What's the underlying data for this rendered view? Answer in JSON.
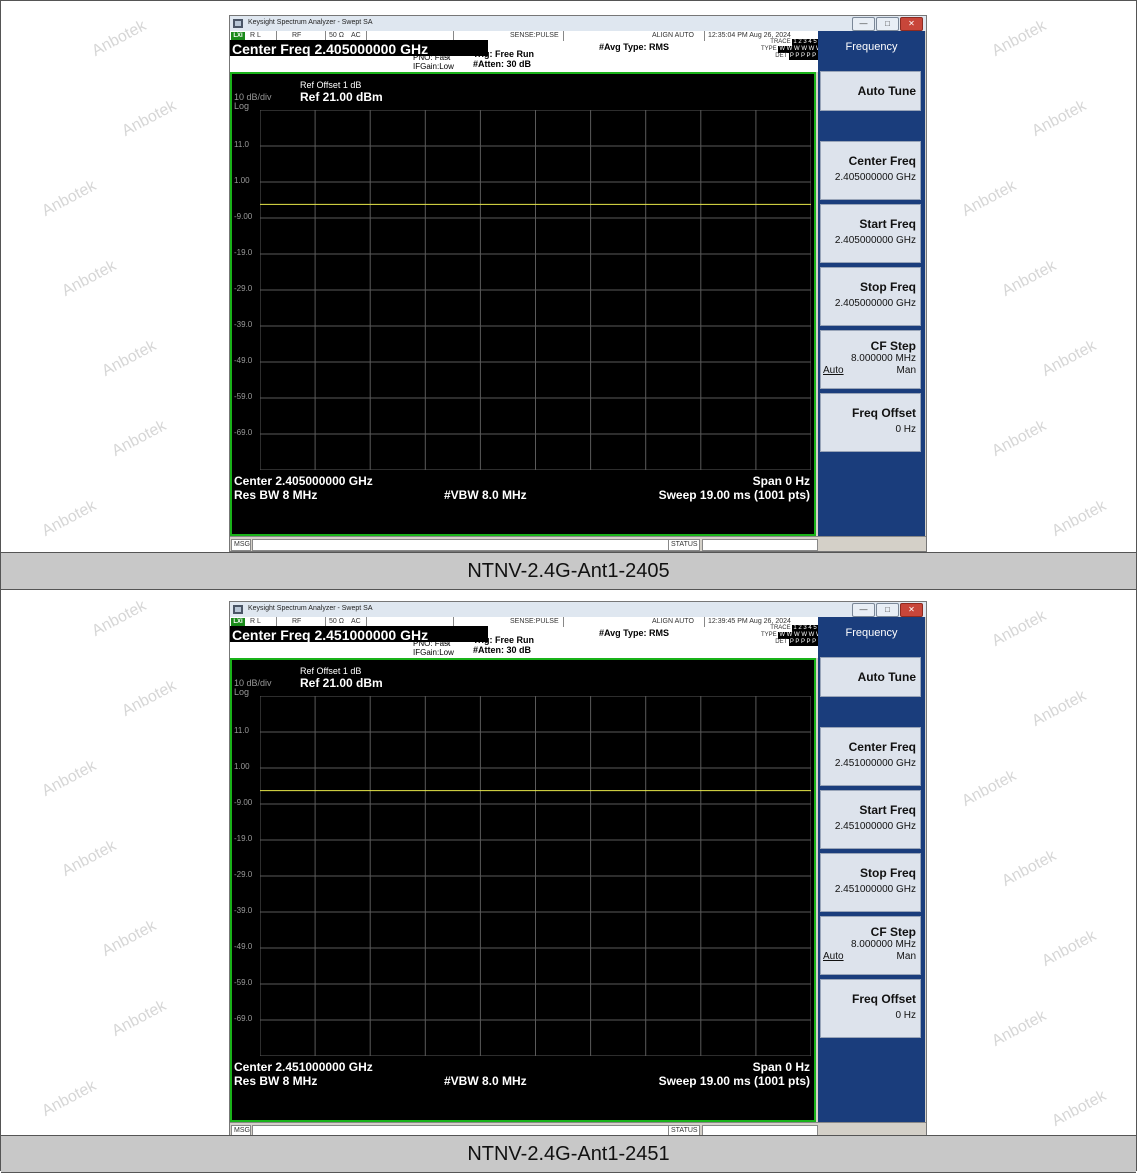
{
  "watermark": "Anbotek",
  "screens": [
    {
      "caption": "NTNV-2.4G-Ant1-2405",
      "window": {
        "title": "Keysight Spectrum Analyzer - Swept SA",
        "lxi": "LXI",
        "rl": "R L",
        "rf": "RF",
        "impedance": "50 Ω",
        "coupling": "AC",
        "sense": "SENSE:PULSE",
        "align": "ALIGN AUTO",
        "timestamp": "12:35:04 PM Aug 26, 2024",
        "center_freq_header": "Center Freq 2.405000000 GHz",
        "pno": "PNO: Fast",
        "ifgain": "IFGain:Low",
        "trig": "Trig: Free Run",
        "atten": "#Atten: 30 dB",
        "avg_type": "#Avg Type: RMS",
        "trace_label": "TRACE",
        "trace_nums": "1 2 3 4 5 6",
        "type_label": "TYPE",
        "type_val": "W W W W W W",
        "det_label": "DET",
        "det_val": "P P P P P P",
        "ref_offset": "Ref Offset 1 dB",
        "ref_level": "Ref 21.00 dBm",
        "scale": "10 dB/div",
        "scale_type": "Log",
        "y_ticks": [
          "11.0",
          "1.00",
          "-9.00",
          "-19.0",
          "-29.0",
          "-39.0",
          "-49.0",
          "-59.0",
          "-69.0"
        ],
        "footer_center": "Center 2.405000000 GHz",
        "footer_span": "Span 0 Hz",
        "footer_rbw": "Res BW 8 MHz",
        "footer_vbw": "#VBW 8.0 MHz",
        "footer_sweep": "Sweep  19.00 ms (1001 pts)",
        "msg": "MSG",
        "status": "STATUS",
        "softkeys": {
          "title": "Frequency",
          "auto_tune": "Auto Tune",
          "center_freq_label": "Center Freq",
          "center_freq_value": "2.405000000 GHz",
          "start_freq_label": "Start Freq",
          "start_freq_value": "2.405000000 GHz",
          "stop_freq_label": "Stop Freq",
          "stop_freq_value": "2.405000000 GHz",
          "cf_step_label": "CF Step",
          "cf_step_value": "8.000000 MHz",
          "cf_step_auto": "Auto",
          "cf_step_man": "Man",
          "freq_offset_label": "Freq Offset",
          "freq_offset_value": "0 Hz"
        }
      },
      "chart_data": {
        "type": "line",
        "title": "",
        "ylabel": "dBm",
        "ylim": [
          -79,
          21
        ],
        "xlim": [
          0,
          19
        ],
        "series": [
          {
            "x": [
              0,
              19
            ],
            "y": [
              -5.2,
              -5.2
            ]
          }
        ]
      }
    },
    {
      "caption": "NTNV-2.4G-Ant1-2451",
      "window": {
        "title": "Keysight Spectrum Analyzer - Swept SA",
        "lxi": "LXI",
        "rl": "R L",
        "rf": "RF",
        "impedance": "50 Ω",
        "coupling": "AC",
        "sense": "SENSE:PULSE",
        "align": "ALIGN AUTO",
        "timestamp": "12:39:45 PM Aug 26, 2024",
        "center_freq_header": "Center Freq 2.451000000 GHz",
        "pno": "PNO: Fast",
        "ifgain": "IFGain:Low",
        "trig": "Trig: Free Run",
        "atten": "#Atten: 30 dB",
        "avg_type": "#Avg Type: RMS",
        "trace_label": "TRACE",
        "trace_nums": "1 2 3 4 5 6",
        "type_label": "TYPE",
        "type_val": "W W W W W W",
        "det_label": "DET",
        "det_val": "P P P P P P",
        "ref_offset": "Ref Offset 1 dB",
        "ref_level": "Ref 21.00 dBm",
        "scale": "10 dB/div",
        "scale_type": "Log",
        "y_ticks": [
          "11.0",
          "1.00",
          "-9.00",
          "-19.0",
          "-29.0",
          "-39.0",
          "-49.0",
          "-59.0",
          "-69.0"
        ],
        "footer_center": "Center 2.451000000 GHz",
        "footer_span": "Span 0 Hz",
        "footer_rbw": "Res BW 8 MHz",
        "footer_vbw": "#VBW 8.0 MHz",
        "footer_sweep": "Sweep  19.00 ms (1001 pts)",
        "msg": "MSG",
        "status": "STATUS",
        "softkeys": {
          "title": "Frequency",
          "auto_tune": "Auto Tune",
          "center_freq_label": "Center Freq",
          "center_freq_value": "2.451000000 GHz",
          "start_freq_label": "Start Freq",
          "start_freq_value": "2.451000000 GHz",
          "stop_freq_label": "Stop Freq",
          "stop_freq_value": "2.451000000 GHz",
          "cf_step_label": "CF Step",
          "cf_step_value": "8.000000 MHz",
          "cf_step_auto": "Auto",
          "cf_step_man": "Man",
          "freq_offset_label": "Freq Offset",
          "freq_offset_value": "0 Hz"
        }
      },
      "chart_data": {
        "type": "line",
        "title": "",
        "ylabel": "dBm",
        "ylim": [
          -79,
          21
        ],
        "xlim": [
          0,
          19
        ],
        "series": [
          {
            "x": [
              0,
              19
            ],
            "y": [
              -5.3,
              -5.3
            ]
          }
        ]
      }
    }
  ],
  "colors": {
    "trace": "#e8e84a",
    "grid": "#5a5a5a",
    "plot_border": "#19b219",
    "softkey_panel": "#1a3d7c",
    "caption_band": "#c8c8c8"
  }
}
